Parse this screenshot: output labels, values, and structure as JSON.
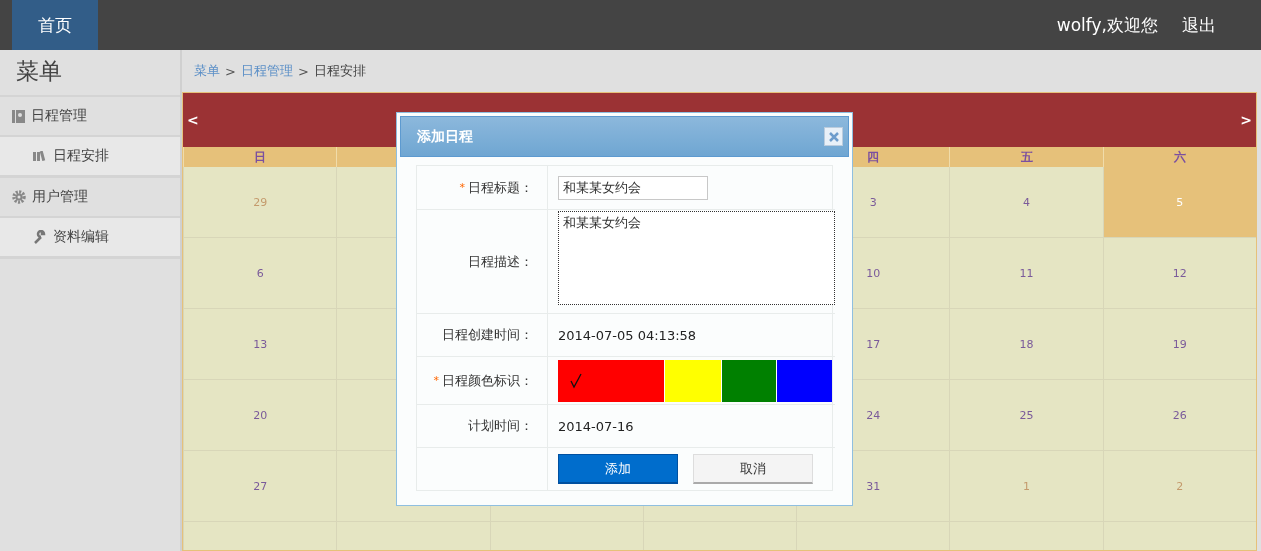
{
  "topbar": {
    "home_tab": {
      "label": "首页",
      "selected": true
    },
    "welcome": "wolfy,欢迎您",
    "logout": "退出"
  },
  "sidebar": {
    "title": "菜单",
    "groups": [
      {
        "label": "日程管理",
        "children": [
          {
            "label": "日程安排"
          }
        ]
      },
      {
        "label": "用户管理",
        "children": [
          {
            "label": "资料编辑"
          }
        ]
      }
    ]
  },
  "breadcrumb": [
    "菜单",
    "日程管理",
    "日程安排"
  ],
  "breadcrumb_separators": [
    ">",
    ">"
  ],
  "calendar": {
    "prev": "<",
    "next": ">",
    "weekdays_left": [
      "日"
    ],
    "weekdays_right": [
      "四",
      "五",
      "六"
    ],
    "weeks": [
      {
        "left": [
          {
            "day": "29",
            "other_month": true,
            "today": false
          }
        ],
        "right": [
          {
            "day": "3",
            "other_month": false,
            "today": false
          },
          {
            "day": "4",
            "other_month": false,
            "today": false
          },
          {
            "day": "5",
            "other_month": false,
            "today": true
          }
        ]
      },
      {
        "left": [
          {
            "day": "6",
            "other_month": false,
            "today": false
          }
        ],
        "right": [
          {
            "day": "10",
            "other_month": false,
            "today": false
          },
          {
            "day": "11",
            "other_month": false,
            "today": false
          },
          {
            "day": "12",
            "other_month": false,
            "today": false
          }
        ]
      },
      {
        "left": [
          {
            "day": "13",
            "other_month": false,
            "today": false
          }
        ],
        "right": [
          {
            "day": "17",
            "other_month": false,
            "today": false
          },
          {
            "day": "18",
            "other_month": false,
            "today": false
          },
          {
            "day": "19",
            "other_month": false,
            "today": false
          }
        ]
      },
      {
        "left": [
          {
            "day": "20",
            "other_month": false,
            "today": false
          }
        ],
        "right": [
          {
            "day": "24",
            "other_month": false,
            "today": false
          },
          {
            "day": "25",
            "other_month": false,
            "today": false
          },
          {
            "day": "26",
            "other_month": false,
            "today": false
          }
        ]
      },
      {
        "left": [
          {
            "day": "27",
            "other_month": false,
            "today": false
          }
        ],
        "right": [
          {
            "day": "31",
            "other_month": false,
            "today": false
          },
          {
            "day": "1",
            "other_month": true,
            "today": false
          },
          {
            "day": "2",
            "other_month": true,
            "today": false
          }
        ]
      }
    ]
  },
  "dialog": {
    "title": "添加日程",
    "fields": [
      {
        "kind": "input",
        "required_mark": "*",
        "label": "日程标题：",
        "value": "和某某女约会"
      },
      {
        "kind": "textarea",
        "label": "日程描述：",
        "value": "和某某女约会"
      },
      {
        "kind": "text",
        "label": "日程创建时间：",
        "value": "2014-07-05 04:13:58"
      },
      {
        "kind": "colors",
        "required_mark": "*",
        "label": "日程颜色标识：",
        "colors": [
          {
            "color": "#ff0000",
            "selected": true
          },
          {
            "color": "#ffff00",
            "selected": false
          },
          {
            "color": "#008000",
            "selected": false
          },
          {
            "color": "#0000ff",
            "selected": false
          }
        ]
      },
      {
        "kind": "text",
        "label": "计划时间：",
        "value": "2014-07-16"
      }
    ],
    "buttons": [
      "添加",
      "取消"
    ]
  }
}
